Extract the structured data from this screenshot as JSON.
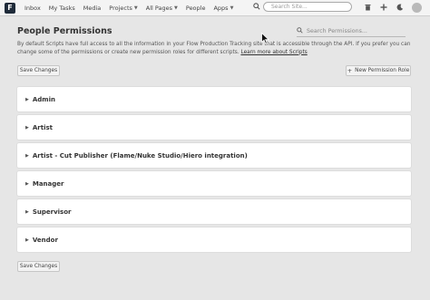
{
  "nav": {
    "logo_letter": "F",
    "items": [
      {
        "label": "Inbox",
        "dropdown": false
      },
      {
        "label": "My Tasks",
        "dropdown": false
      },
      {
        "label": "Media",
        "dropdown": false
      },
      {
        "label": "Projects",
        "dropdown": true
      },
      {
        "label": "All Pages",
        "dropdown": true
      },
      {
        "label": "People",
        "dropdown": false
      },
      {
        "label": "Apps",
        "dropdown": true
      }
    ],
    "search_placeholder": "Search Site...",
    "icons": [
      "search-icon",
      "trash-icon",
      "plus-icon",
      "night-mode-icon",
      "avatar"
    ]
  },
  "page": {
    "title": "People Permissions",
    "search_placeholder": "Search Permissions...",
    "description": "By default Scripts have full access to all the information in your Flow Production Tracking site that is accessible through the API. If you prefer you can change some of the permissions or create new permission roles for different scripts.",
    "learn_more": "Learn more about Scripts",
    "save_label": "Save Changes",
    "new_role_label": "New Permission Role",
    "new_role_icon": "+"
  },
  "roles": [
    {
      "label": "Admin"
    },
    {
      "label": "Artist"
    },
    {
      "label": "Artist - Cut Publisher (Flame/Nuke Studio/Hiero integration)"
    },
    {
      "label": "Manager"
    },
    {
      "label": "Supervisor"
    },
    {
      "label": "Vendor"
    }
  ]
}
